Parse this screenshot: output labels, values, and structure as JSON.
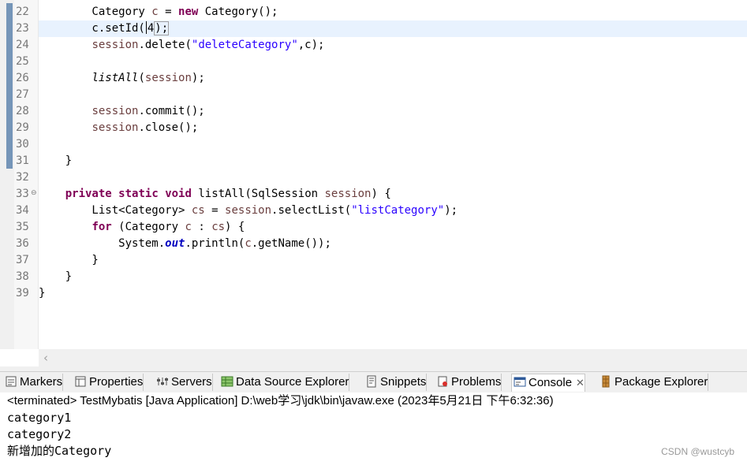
{
  "editor": {
    "line_numbers": [
      "22",
      "23",
      "24",
      "25",
      "26",
      "27",
      "28",
      "29",
      "30",
      "31",
      "32",
      "33",
      "34",
      "35",
      "36",
      "37",
      "38",
      "39"
    ],
    "lines": {
      "l22": {
        "t1": "        Category ",
        "t2": "c",
        "t3": " = ",
        "t4": "new",
        "t5": " Category();"
      },
      "l23": {
        "t1": "        c.setId(",
        "t2": "4",
        "t3": ");"
      },
      "l24": {
        "t1": "        ",
        "t2": "session",
        "t3": ".delete(",
        "t4": "\"deleteCategory\"",
        "t5": ",c);"
      },
      "l26": {
        "t1": "        ",
        "t2": "listAll",
        "t3": "(",
        "t4": "session",
        "t5": ");"
      },
      "l28": {
        "t1": "        ",
        "t2": "session",
        "t3": ".commit();"
      },
      "l29": {
        "t1": "        ",
        "t2": "session",
        "t3": ".close();"
      },
      "l31": {
        "t1": "    }"
      },
      "l33": {
        "t1": "    ",
        "t2": "private",
        "t3": " ",
        "t4": "static",
        "t5": " ",
        "t6": "void",
        "t7": " listAll(SqlSession ",
        "t8": "session",
        "t9": ") {"
      },
      "l34": {
        "t1": "        List<Category> ",
        "t2": "cs",
        "t3": " = ",
        "t4": "session",
        "t5": ".selectList(",
        "t6": "\"listCategory\"",
        "t7": ");"
      },
      "l35": {
        "t1": "        ",
        "t2": "for",
        "t3": " (Category ",
        "t4": "c",
        "t5": " : ",
        "t6": "cs",
        "t7": ") {"
      },
      "l36": {
        "t1": "            System.",
        "t2": "out",
        "t3": ".println(",
        "t4": "c",
        "t5": ".getName());"
      },
      "l37": {
        "t1": "        }"
      },
      "l38": {
        "t1": "    }"
      },
      "l39": {
        "t1": "}"
      }
    },
    "fold_icon": "⊖",
    "scroll_left_icon": "‹"
  },
  "tabs": [
    {
      "label": "Markers"
    },
    {
      "label": "Properties"
    },
    {
      "label": "Servers"
    },
    {
      "label": "Data Source Explorer"
    },
    {
      "label": "Snippets"
    },
    {
      "label": "Problems"
    },
    {
      "label": "Console",
      "close": "✕"
    },
    {
      "label": "Package Explorer"
    }
  ],
  "console": {
    "header": "<terminated> TestMybatis [Java Application] D:\\web学习\\jdk\\bin\\javaw.exe (2023年5月21日 下午6:32:36)",
    "output": [
      "category1",
      "category2",
      "新增加的Category"
    ]
  },
  "watermark": "CSDN @wustcyb"
}
